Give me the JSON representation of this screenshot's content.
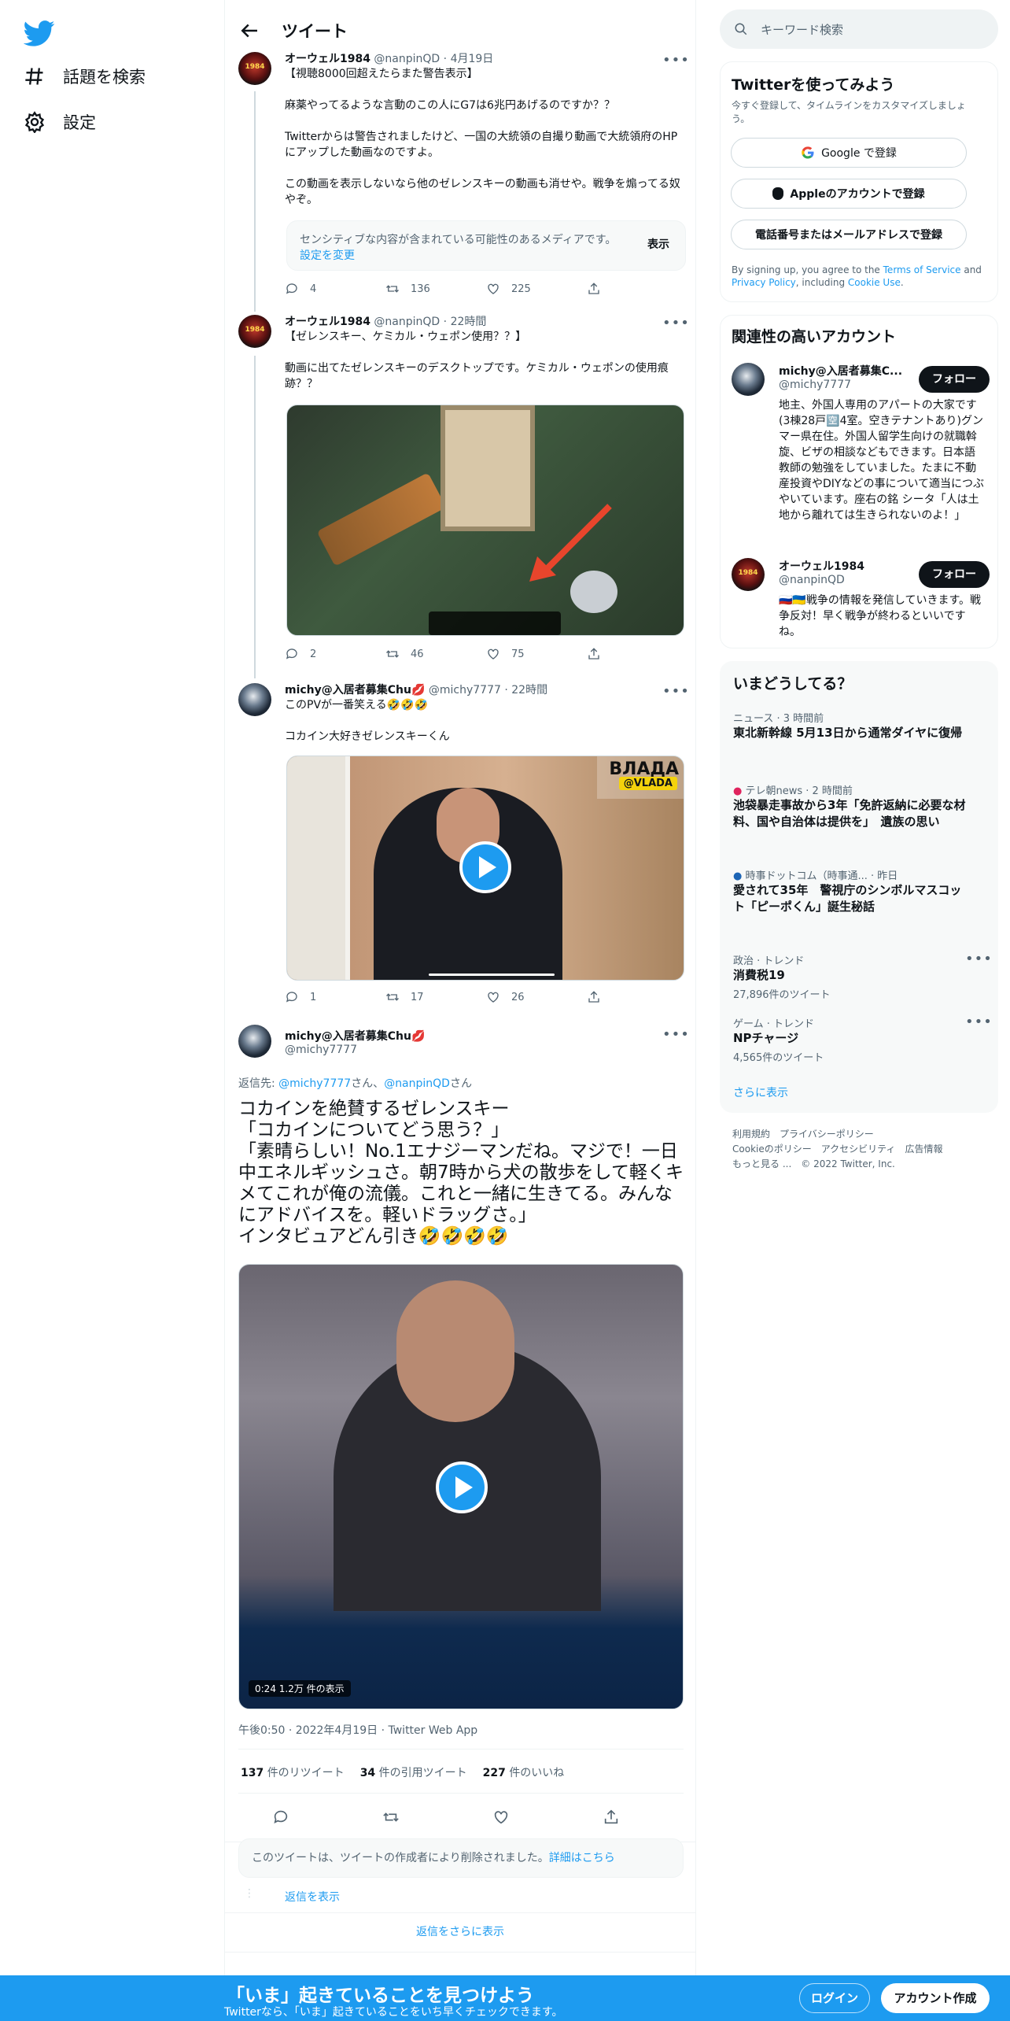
{
  "nav": {
    "items": [
      {
        "label": "話題を検索",
        "icon": "hash-icon"
      },
      {
        "label": "設定",
        "icon": "gear-icon"
      }
    ]
  },
  "header": {
    "title": "ツイート"
  },
  "tweets": [
    {
      "name": "オーウェル1984",
      "handle": "@nanpinQD",
      "time": "4月19日",
      "text": "【視聴8000回超えたらまた警告表示】\n\n麻薬やってるような言動のこの人にG7は6兆円あげるのですか？？\n\nTwitterからは警告されましたけど、一国の大統領の自撮り動画で大統領府のHPにアップした動画なのですよ。\n\nこの動画を表示しないなら他のゼレンスキーの動画も消せや。戦争を煽ってる奴やぞ。",
      "sensitive": {
        "text": "センシティブな内容が含まれている可能性のあるメディアです。",
        "link": "設定を変更",
        "show": "表示"
      },
      "replies": "4",
      "retweets": "136",
      "likes": "225"
    },
    {
      "name": "オーウェル1984",
      "handle": "@nanpinQD",
      "time": "22時間",
      "text": "【ゼレンスキー、ケミカル・ウェポン使用？？】\n\n動画に出てたゼレンスキーのデスクトップです。ケミカル・ウェポンの使用痕跡？？",
      "replies": "2",
      "retweets": "46",
      "likes": "75"
    },
    {
      "name": "michy@入居者募集Chu💋",
      "handle": "@michy7777",
      "time": "22時間",
      "text": "このPVが一番笑える🤣🤣🤣\n\nコカイン大好きゼレンスキーくん",
      "media_tag": "ВЛАДА",
      "media_sub": "@VLADA",
      "replies": "1",
      "retweets": "17",
      "likes": "26"
    }
  ],
  "main_tweet": {
    "name": "michy@入居者募集Chu💋",
    "handle": "@michy7777",
    "reply_to_prefix": "返信先: ",
    "reply_to_1": "@michy7777",
    "reply_to_sep": "さん、",
    "reply_to_2": "@nanpinQD",
    "reply_to_suffix": "さん",
    "text": "コカインを絶賛するゼレンスキー\n「コカインについてどう思う？」\n「素晴らしい！No.1エナジーマンだね。マジで！一日中エネルギッシュさ。朝7時から犬の散歩をして軽くキメてこれが俺の流儀。これと一緒に生きてる。みんなにアドバイスを。軽いドラッグさ。」\nインタビュアどん引き🤣🤣🤣🤣",
    "video_time": "0:24",
    "video_views": "1.2万 件の表示",
    "timestamp": "午後0:50 · 2022年4月19日 · Twitter Web App",
    "retweets_n": "137",
    "retweets_l": "件のリツイート",
    "quotes_n": "34",
    "quotes_l": "件の引用ツイート",
    "likes_n": "227",
    "likes_l": "件のいいね"
  },
  "deleted": {
    "text": "このツイートは、ツイートの作成者により削除されました。",
    "link": "詳細はこちら"
  },
  "show_replies": "返信を表示",
  "more_replies": "返信をさらに表示",
  "search": {
    "placeholder": "キーワード検索"
  },
  "signup": {
    "title": "Twitterを使ってみよう",
    "sub": "今すぐ登録して、タイムラインをカスタマイズしましょう。",
    "google": "Google で登録",
    "apple": "Appleのアカウントで登録",
    "phone": "電話番号またはメールアドレスで登録",
    "legal_1": "By signing up, you agree to the ",
    "tos": "Terms of Service",
    "legal_2": " and ",
    "privacy": "Privacy Policy",
    "legal_3": ", including ",
    "cookie": "Cookie Use",
    "legal_4": "."
  },
  "related": {
    "title": "関連性の高いアカウント",
    "follow": "フォロー",
    "accounts": [
      {
        "name": "michy@入居者募集C...",
        "handle": "@michy7777",
        "bio": "地主、外国人専用のアパートの大家です(3棟28戸🈳4室。空きテナントあり)グンマー県在住。外国人留学生向けの就職斡旋、ビザの相談などもできます。日本語教師の勉強をしていました。たまに不動産投資やDIYなどの事について適当につぶやいています。座右の銘 シータ「人は土地から離れては生きられないのよ！」"
      },
      {
        "name": "オーウェル1984",
        "handle": "@nanpinQD",
        "bio": "🇷🇺🇺🇦戦争の情報を発信していきます。戦争反対！早く戦争が終わるといいですね。"
      }
    ]
  },
  "trends": {
    "title": "いまどうしてる？",
    "items": [
      {
        "meta": "ニュース · 3 時間前",
        "title": "東北新幹線 5月13日から通常ダイヤに復帰"
      },
      {
        "meta": "テレ朝news · 2 時間前",
        "title": "池袋暴走事故から3年「免許返納に必要な材料、国や自治体は提供を」　遺族の思い"
      },
      {
        "meta": "時事ドットコム（時事通... · 昨日",
        "title": "愛されて35年　警視庁のシンボルマスコット「ピーポくん」誕生秘話"
      },
      {
        "meta": "政治 · トレンド",
        "title": "消費税19",
        "count": "27,896件のツイート"
      },
      {
        "meta": "ゲーム · トレンド",
        "title": "NPチャージ",
        "count": "4,565件のツイート"
      }
    ],
    "more": "さらに表示"
  },
  "footer": {
    "l1a": "利用規約",
    "l1b": "プライバシーポリシー",
    "l2a": "Cookieのポリシー",
    "l2b": "アクセシビリティ",
    "l2c": "広告情報",
    "l3a": "もっと見る ...",
    "l3b": "© 2022 Twitter, Inc."
  },
  "bottom": {
    "title": "「いま」起きていることを見つけよう",
    "sub": "Twitterなら、「いま」起きていることをいち早くチェックできます。",
    "login": "ログイン",
    "signup": "アカウント作成"
  },
  "colors": {
    "accent": "#1d9bf0",
    "text": "#0f1419",
    "muted": "#536471"
  }
}
